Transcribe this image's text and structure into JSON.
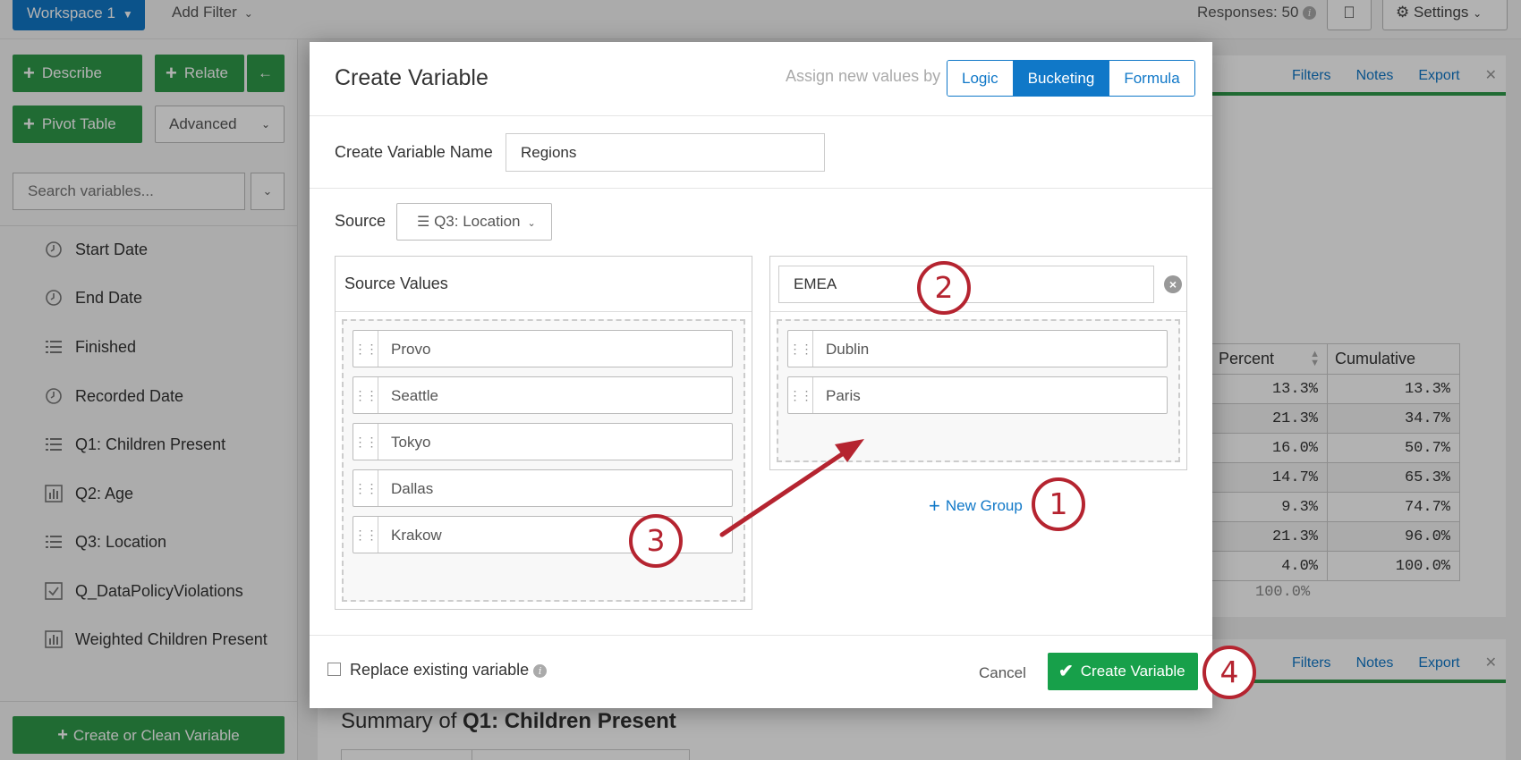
{
  "topbar": {
    "workspace_label": "Workspace 1",
    "add_filter_label": "Add Filter",
    "responses_label": "Responses: 50",
    "settings_label": "Settings"
  },
  "sidebar": {
    "describe_label": "Describe",
    "relate_label": "Relate",
    "pivot_label": "Pivot Table",
    "advanced_label": "Advanced",
    "search_placeholder": "Search variables...",
    "variables": [
      {
        "label": "Start Date",
        "icon": "clock-icon"
      },
      {
        "label": "End Date",
        "icon": "clock-icon"
      },
      {
        "label": "Finished",
        "icon": "list-icon"
      },
      {
        "label": "Recorded Date",
        "icon": "clock-icon"
      },
      {
        "label": "Q1: Children Present",
        "icon": "list-icon"
      },
      {
        "label": "Q2: Age",
        "icon": "bar-chart-icon"
      },
      {
        "label": "Q3: Location",
        "icon": "list-icon"
      },
      {
        "label": "Q_DataPolicyViolations",
        "icon": "checkbox-icon"
      },
      {
        "label": "Weighted Children Present",
        "icon": "bar-chart-icon"
      }
    ],
    "create_clean_label": "Create or Clean Variable"
  },
  "card": {
    "filters_label": "Filters",
    "notes_label": "Notes",
    "export_label": "Export",
    "headers": [
      "Percent",
      "Cumulative"
    ],
    "rows": [
      [
        "13.3%",
        "13.3%"
      ],
      [
        "21.3%",
        "34.7%"
      ],
      [
        "16.0%",
        "50.7%"
      ],
      [
        "14.7%",
        "65.3%"
      ],
      [
        "9.3%",
        "74.7%"
      ],
      [
        "21.3%",
        "96.0%"
      ],
      [
        "4.0%",
        "100.0%"
      ]
    ],
    "total": "100.0%"
  },
  "summary": {
    "prefix": "Summary of",
    "variable": "Q1: Children Present"
  },
  "modal": {
    "title": "Create Variable",
    "assign_label": "Assign new values by",
    "modes": [
      "Logic",
      "Bucketing",
      "Formula"
    ],
    "active_mode": "Bucketing",
    "name_label": "Create Variable Name",
    "name_value": "Regions",
    "source_label": "Source",
    "source_value": "Q3: Location",
    "source_values_title": "Source Values",
    "source_values": [
      "Provo",
      "Seattle",
      "Tokyo",
      "Dallas",
      "Krakow"
    ],
    "group_name": "EMEA",
    "group_values": [
      "Dublin",
      "Paris"
    ],
    "new_group_label": "New Group",
    "replace_label": "Replace existing variable",
    "cancel_label": "Cancel",
    "create_label": "Create Variable"
  },
  "callouts": [
    "1",
    "2",
    "3",
    "4"
  ],
  "colors": {
    "accent_blue": "#1078c8",
    "button_green": "#17a04a",
    "callout_red": "#b52430"
  }
}
